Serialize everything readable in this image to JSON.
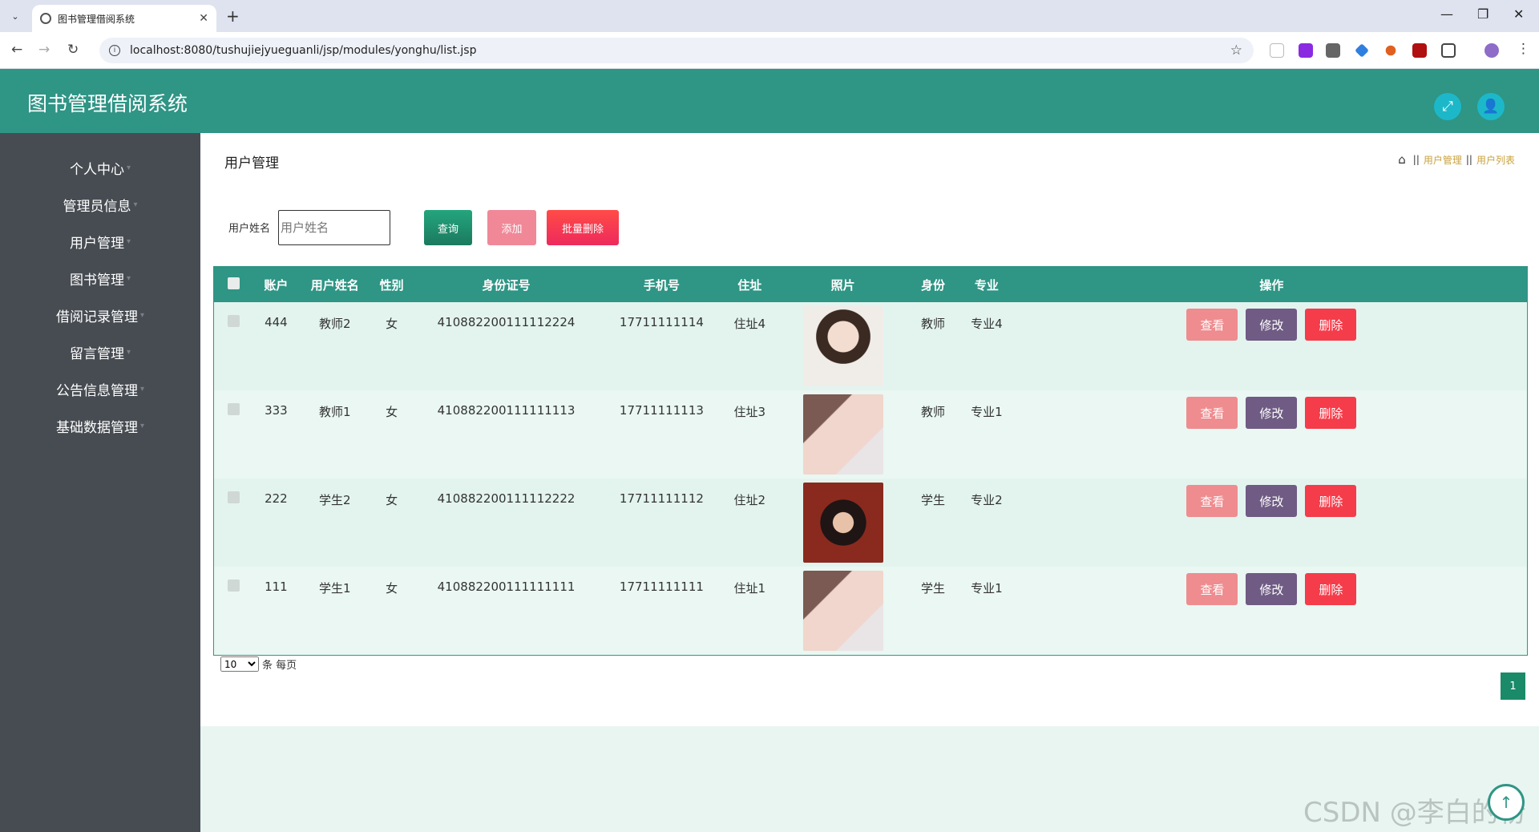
{
  "browser": {
    "tab_title": "图书管理借阅系统",
    "url": "localhost:8080/tushujiejyueguanli/jsp/modules/yonghu/list.jsp"
  },
  "app": {
    "title": "图书管理借阅系统"
  },
  "sidebar": {
    "items": [
      {
        "label": "个人中心"
      },
      {
        "label": "管理员信息"
      },
      {
        "label": "用户管理"
      },
      {
        "label": "图书管理"
      },
      {
        "label": "借阅记录管理"
      },
      {
        "label": "留言管理"
      },
      {
        "label": "公告信息管理"
      },
      {
        "label": "基础数据管理"
      }
    ]
  },
  "main": {
    "page_title": "用户管理",
    "breadcrumb": [
      "用户管理",
      "用户列表"
    ],
    "search": {
      "label": "用户姓名",
      "placeholder": "用户姓名",
      "query_label": "查询",
      "add_label": "添加",
      "batch_delete_label": "批量删除"
    },
    "table": {
      "headers": [
        "账户",
        "用户姓名",
        "性别",
        "身份证号",
        "手机号",
        "住址",
        "照片",
        "身份",
        "专业",
        "操作"
      ],
      "rows": [
        {
          "account": "444",
          "name": "教师2",
          "gender": "女",
          "id_number": "410882200111112224",
          "phone": "17711111114",
          "address": "住址4",
          "role": "教师",
          "major": "专业4"
        },
        {
          "account": "333",
          "name": "教师1",
          "gender": "女",
          "id_number": "410882200111111113",
          "phone": "17711111113",
          "address": "住址3",
          "role": "教师",
          "major": "专业1"
        },
        {
          "account": "222",
          "name": "学生2",
          "gender": "女",
          "id_number": "410882200111112222",
          "phone": "17711111112",
          "address": "住址2",
          "role": "学生",
          "major": "专业2"
        },
        {
          "account": "111",
          "name": "学生1",
          "gender": "女",
          "id_number": "410882200111111111",
          "phone": "17711111111",
          "address": "住址1",
          "role": "学生",
          "major": "专业1"
        }
      ],
      "actions": {
        "view": "查看",
        "edit": "修改",
        "delete": "删除"
      }
    },
    "pagination": {
      "page_size": "10",
      "page_size_suffix": "条 每页",
      "current_page": "1"
    }
  },
  "watermark": "CSDN @李白的粉"
}
